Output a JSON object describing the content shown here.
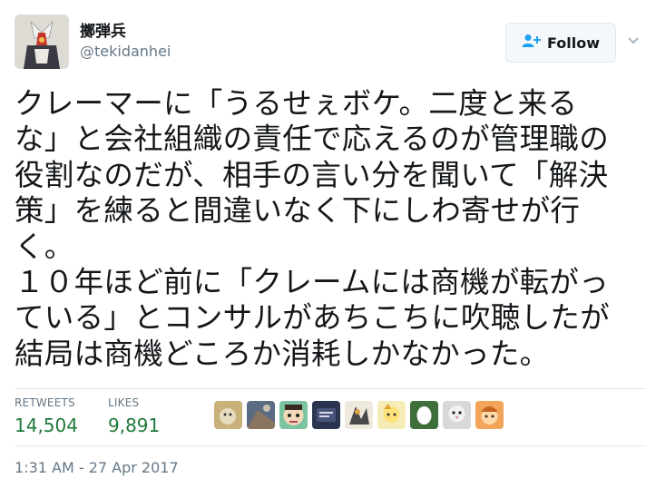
{
  "user": {
    "display_name": "擲弾兵",
    "handle": "@tekidanhei"
  },
  "follow_button": {
    "label": "Follow"
  },
  "tweet": {
    "lines": [
      "クレーマーに「うるせぇボケ。二度と来る",
      "な」と会社組織の責任で応えるのが管理職の",
      "役割なのだが、相手の言い分を聞いて「解決",
      "策」を練ると間違いなく下にしわ寄せが行",
      "く。",
      "１０年ほど前に「クレームには商機が転がっ",
      "ている」とコンサルがあちこちに吹聴したが",
      "結局は商機どころか消耗しかなかった。"
    ]
  },
  "stats": {
    "retweets_label": "RETWEETS",
    "retweets_value": "14,504",
    "likes_label": "LIKES",
    "likes_value": "9,891"
  },
  "timestamp": "1:31 AM - 27 Apr 2017",
  "colors": {
    "stat_value": "#1f7a3a",
    "secondary_text": "#657786",
    "divider": "#e1e8ed",
    "follow_icon": "#1da1f2"
  }
}
